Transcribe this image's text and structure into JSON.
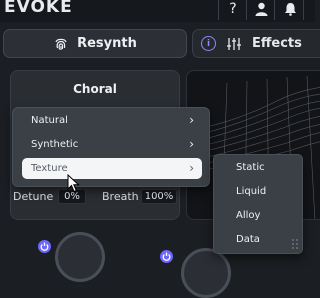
{
  "header": {
    "logo": "EVOKE",
    "help_icon": "?",
    "icons": [
      "help-icon",
      "user-icon",
      "bell-icon"
    ]
  },
  "tabs": {
    "resynth": "Resynth",
    "effects": "Effects"
  },
  "preset": {
    "name": "Choral"
  },
  "params": {
    "detune_label": "Detune",
    "detune_value": "0%",
    "breath_label": "Breath",
    "breath_value": "100%"
  },
  "menu": {
    "items": [
      {
        "label": "Natural"
      },
      {
        "label": "Synthetic"
      },
      {
        "label": "Texture"
      }
    ],
    "submenu": [
      {
        "label": "Static"
      },
      {
        "label": "Liquid"
      },
      {
        "label": "Alloy"
      },
      {
        "label": "Data"
      }
    ]
  },
  "colors": {
    "accent": "#6d66ff",
    "background": "#1b1e23",
    "menu_bg": "#3b4047",
    "active_item": "#f4f5f7"
  }
}
